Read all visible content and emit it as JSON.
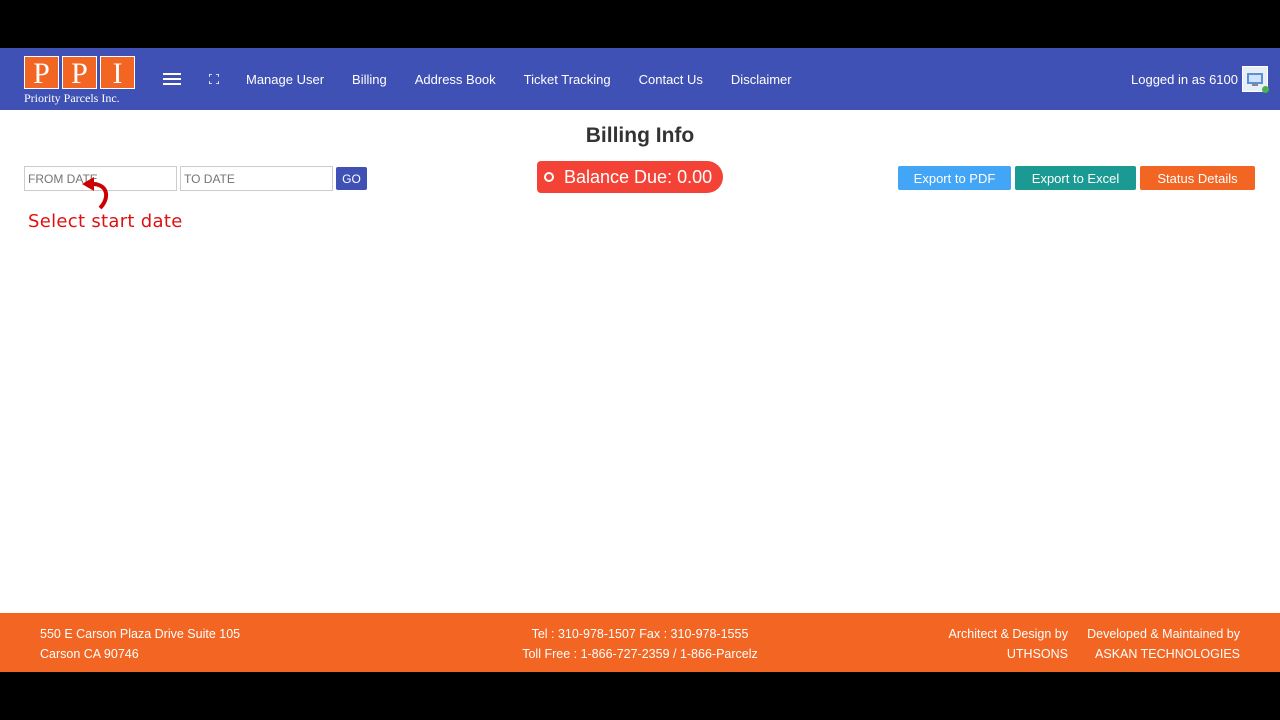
{
  "brand": {
    "letters": [
      "P",
      "P",
      "I"
    ],
    "subtitle": "Priority Parcels Inc."
  },
  "nav": [
    "Manage User",
    "Billing",
    "Address Book",
    "Ticket Tracking",
    "Contact Us",
    "Disclaimer"
  ],
  "login": {
    "text": "Logged in as 6100"
  },
  "page": {
    "title": "Billing Info"
  },
  "filters": {
    "from_placeholder": "FROM DATE",
    "to_placeholder": "TO DATE",
    "go_label": "GO"
  },
  "balance": {
    "label": "Balance Due: 0.00"
  },
  "actions": {
    "pdf": "Export to PDF",
    "excel": "Export to Excel",
    "status": "Status Details"
  },
  "hint": {
    "text": "Select  start date"
  },
  "footer": {
    "address_line1": "550 E Carson Plaza Drive Suite 105",
    "address_line2": "Carson CA 90746",
    "phone_line1": "Tel : 310-978-1507 Fax : 310-978-1555",
    "phone_line2": "Toll Free : 1-866-727-2359 / 1-866-Parcelz",
    "architect_label": "Architect & Design by",
    "architect_name": "UTHSONS",
    "developer_label": "Developed & Maintained by",
    "developer_name": "ASKAN TECHNOLOGIES"
  },
  "colors": {
    "topbar": "#3f51b5",
    "accent_orange": "#f26522",
    "balance_red": "#f44336",
    "pdf_blue": "#42a5f5",
    "excel_teal": "#1a9a93",
    "status_orange": "#f26522"
  },
  "icons": [
    "menu-icon",
    "fullscreen-icon",
    "user-avatar-icon",
    "balance-circle-icon",
    "curved-arrow-icon"
  ]
}
